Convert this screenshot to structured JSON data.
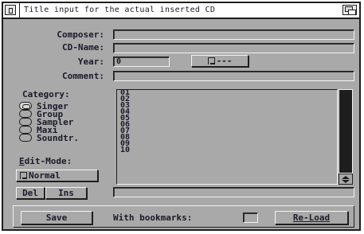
{
  "window": {
    "title": "Title input for the actual inserted CD"
  },
  "form": {
    "composer": {
      "label": "Composer:",
      "value": ""
    },
    "cd_name": {
      "label": "CD-Name:",
      "value": ""
    },
    "year": {
      "label": "Year:",
      "value": "0"
    },
    "year_cycle": {
      "label": "---"
    },
    "comment": {
      "label": "Comment:",
      "value": ""
    }
  },
  "category": {
    "label": "Category:",
    "options": [
      "Singer",
      "Group",
      "Sampler",
      "Maxi",
      "Soundtr."
    ],
    "selected": "Singer"
  },
  "tracks": [
    "01",
    "02",
    "03",
    "04",
    "05",
    "06",
    "07",
    "08",
    "09",
    "10"
  ],
  "edit_mode": {
    "label": "Edit-Mode:",
    "value": "Normal"
  },
  "buttons": {
    "del": "Del",
    "ins": "Ins",
    "save": "Save",
    "reload": "Re-Load"
  },
  "bookmarks": {
    "label": "With bookmarks:"
  },
  "track_edit": {
    "value": ""
  }
}
